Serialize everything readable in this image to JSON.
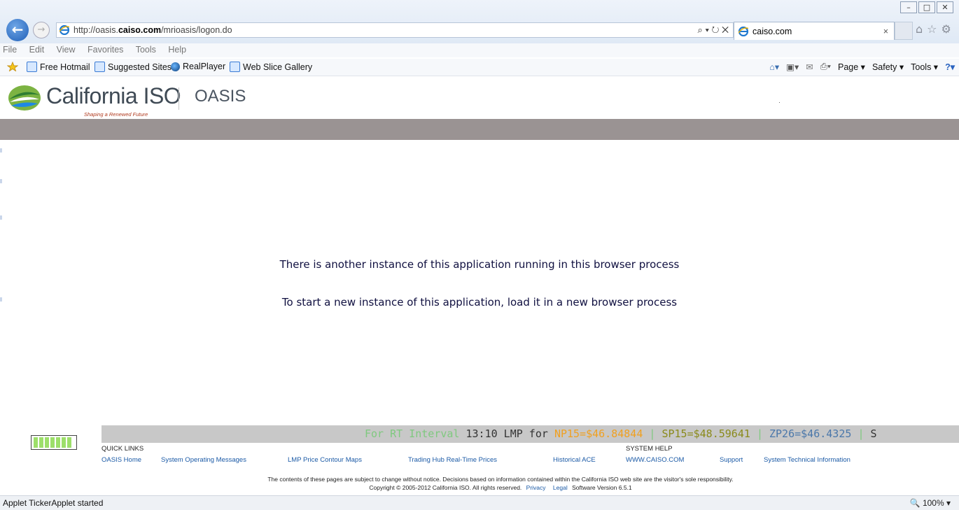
{
  "browser": {
    "address": {
      "prefix": "http://oasis.",
      "host": "caiso.com",
      "path": "/mrioasis/logon.do"
    },
    "address_controls": "⌕ ▾ ↻ ✕",
    "tab": {
      "label": "caiso.com",
      "close": "×"
    },
    "menu": [
      "File",
      "Edit",
      "View",
      "Favorites",
      "Tools",
      "Help"
    ],
    "favorites": [
      "Free Hotmail",
      "Suggested Sites",
      "RealPlayer",
      "Web Slice Gallery"
    ],
    "commands": {
      "page": "Page ▾",
      "safety": "Safety ▾",
      "tools": "Tools ▾"
    },
    "status_text": "Applet TickerApplet started",
    "zoom": "100%",
    "icon_names": [
      "back-arrow-icon",
      "forward-arrow-icon",
      "ie-logo-icon",
      "home-icon",
      "star-icon",
      "gear-icon",
      "feeds-icon",
      "mail-icon",
      "print-icon",
      "help-icon"
    ]
  },
  "page": {
    "logo_text": "California ISO",
    "tagline": "Shaping a Renewed Future",
    "app_name": "OASIS",
    "messages": [
      "There is another instance of this application running in this browser process",
      "To start a new instance of this application, load it in a new browser process"
    ]
  },
  "ticker": {
    "prefix": "For RT Interval",
    "time": "13:10 LMP for",
    "np15": "NP15=$46.84844",
    "sp15": "SP15=$48.59641",
    "zp26": "ZP26=$46.4325",
    "separator": "|",
    "trailing": "S"
  },
  "footer": {
    "quick_links_label": "QUICK LINKS",
    "system_help_label": "SYSTEM HELP",
    "links": {
      "oasis_home": "OASIS Home",
      "system_messages": "System Operating Messages",
      "lmp_maps": "LMP Price Contour Maps",
      "trading_hub": "Trading Hub Real-Time Prices",
      "historical_ace": "Historical ACE",
      "caiso_www": "WWW.CAISO.COM",
      "support": "Support",
      "tech_info": "System Technical Information"
    },
    "disclaimer": "The contents of these pages are subject to change without notice. Decisions based on information contained within the California ISO web site are the visitor's sole responsibility.",
    "copyright": "Copyright © 2005-2012 California ISO. All rights reserved.",
    "privacy": "Privacy",
    "legal": "Legal",
    "version": "Software Version 6.5.1"
  },
  "colors": {
    "header_bar": "#9a9393",
    "ticker_bg": "#c8c8c8",
    "link": "#1b5aa6",
    "message_text": "#101040"
  }
}
